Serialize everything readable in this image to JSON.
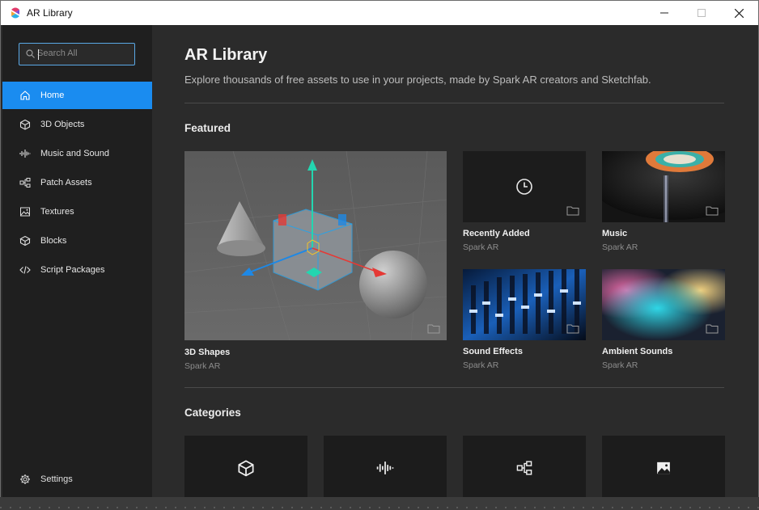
{
  "window": {
    "title": "AR Library",
    "controls": [
      "minimize-icon",
      "maximize-icon",
      "close-icon"
    ]
  },
  "sidebar": {
    "search": {
      "placeholder": "Search All",
      "value": ""
    },
    "items": [
      {
        "label": "Home",
        "icon": "home-icon",
        "active": true
      },
      {
        "label": "3D Objects",
        "icon": "cube-icon",
        "active": false
      },
      {
        "label": "Music and Sound",
        "icon": "waveform-icon",
        "active": false
      },
      {
        "label": "Patch Assets",
        "icon": "patch-icon",
        "active": false
      },
      {
        "label": "Textures",
        "icon": "image-icon",
        "active": false
      },
      {
        "label": "Blocks",
        "icon": "block-icon",
        "active": false
      },
      {
        "label": "Script Packages",
        "icon": "code-icon",
        "active": false
      }
    ],
    "settings_label": "Settings"
  },
  "main": {
    "title": "AR Library",
    "subtitle": "Explore thousands of free assets to use in your projects, made by Spark AR creators and Sketchfab.",
    "featured_title": "Featured",
    "featured": [
      {
        "title": "3D Shapes",
        "author": "Spark AR"
      },
      {
        "title": "Recently Added",
        "author": "Spark AR"
      },
      {
        "title": "Music",
        "author": "Spark AR"
      },
      {
        "title": "Sound Effects",
        "author": "Spark AR"
      },
      {
        "title": "Ambient Sounds",
        "author": "Spark AR"
      }
    ],
    "categories_title": "Categories",
    "categories": [
      {
        "icon": "cube-icon"
      },
      {
        "icon": "waveform-icon"
      },
      {
        "icon": "patch-icon"
      },
      {
        "icon": "image-icon"
      }
    ]
  },
  "colors": {
    "accent": "#1a8cf0",
    "sidebar_bg": "#1f1f1f",
    "main_bg": "#2b2b2b",
    "tile_bg": "#1c1c1c"
  }
}
